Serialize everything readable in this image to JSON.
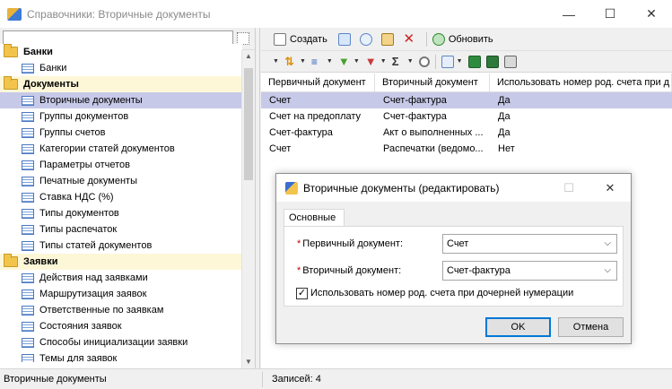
{
  "window": {
    "title": "Справочники: Вторичные документы",
    "controls": {
      "minimize": "—",
      "maximize": "☐",
      "close": "✕"
    }
  },
  "search": {
    "value": "",
    "placeholder": ""
  },
  "tree": {
    "groups": [
      {
        "label": "Банки",
        "children": [
          "Банки"
        ]
      },
      {
        "label": "Документы",
        "children": [
          "Вторичные документы",
          "Группы документов",
          "Группы счетов",
          "Категории статей документов",
          "Параметры отчетов",
          "Печатные документы",
          "Ставка НДС (%)",
          "Типы документов",
          "Типы распечаток",
          "Типы статей документов"
        ]
      },
      {
        "label": "Заявки",
        "children": [
          "Действия над заявками",
          "Маршрутизация заявок",
          "Ответственные по заявкам",
          "Состояния заявок",
          "Способы инициализации заявки",
          "Темы для заявок"
        ]
      }
    ],
    "selected": "Вторичные документы"
  },
  "toolbar": {
    "create_label": "Создать",
    "refresh_label": "Обновить"
  },
  "grid": {
    "columns": [
      "Первичный документ",
      "Вторичный документ",
      "Использовать номер род. счета при д"
    ],
    "rows": [
      [
        "Счет",
        "Счет-фактура",
        "Да"
      ],
      [
        "Счет на предоплату",
        "Счет-фактура",
        "Да"
      ],
      [
        "Счет-фактура",
        "Акт о выполненных ...",
        "Да"
      ],
      [
        "Счет",
        "Распечатки (ведомо...",
        "Нет"
      ]
    ]
  },
  "status": {
    "left": "Вторичные документы",
    "records": "Записей: 4"
  },
  "dialog": {
    "title": "Вторичные документы (редактировать)",
    "controls": {
      "maximize": "☐",
      "close": "✕"
    },
    "tab": "Основные",
    "primary_label": "Первичный документ:",
    "primary_value": "Счет",
    "secondary_label": "Вторичный документ:",
    "secondary_value": "Счет-фактура",
    "checkbox_label": "Использовать номер род. счета при дочерней нумерации",
    "checkbox_checked": true,
    "ok_label": "OK",
    "cancel_label": "Отмена"
  }
}
